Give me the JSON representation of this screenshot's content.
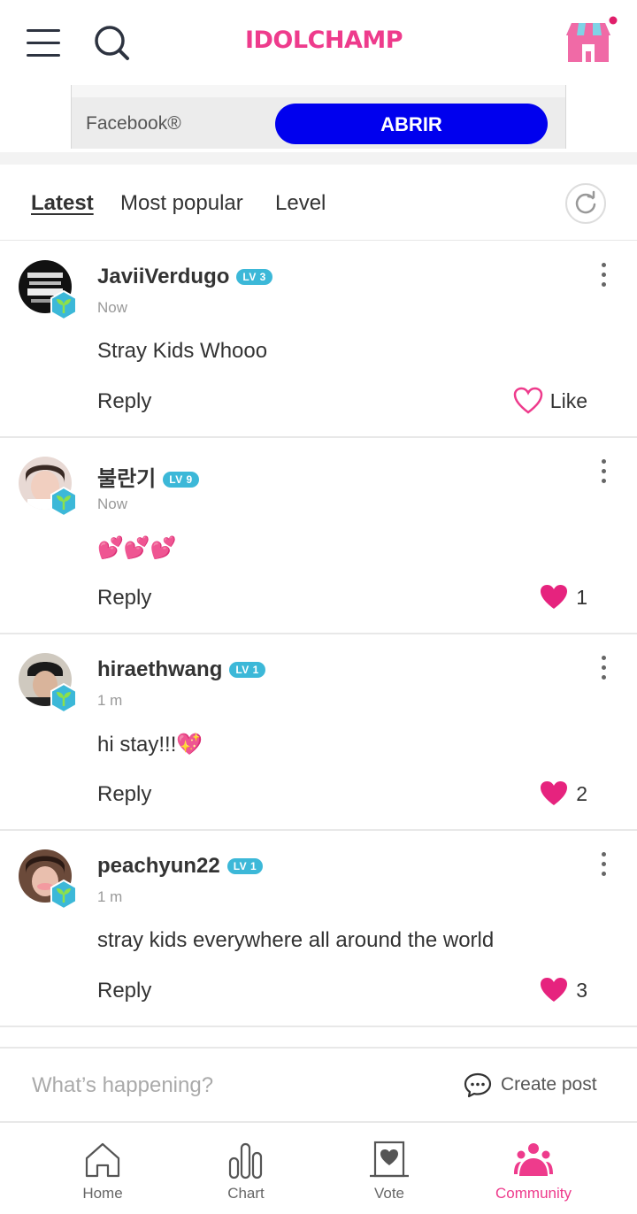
{
  "header": {
    "logo": "IDOLCHAMP",
    "menu_icon": "hamburger-menu-icon",
    "search_icon": "search-icon",
    "shop_icon": "shop-icon"
  },
  "ad": {
    "brand": "Facebook®",
    "button_label": "ABRIR",
    "button_color": "#0000ee"
  },
  "tabs": [
    {
      "label": "Latest",
      "active": true
    },
    {
      "label": "Most popular",
      "active": false
    },
    {
      "label": "Level",
      "active": false
    }
  ],
  "comments": [
    {
      "username": "JaviiVerdugo",
      "level": "LV 3",
      "time": "Now",
      "text": "Stray Kids Whooo",
      "reply_label": "Reply",
      "like_label": "Like",
      "liked": false
    },
    {
      "username": "불란기",
      "level": "LV 9",
      "time": "Now",
      "text": "💕💕💕",
      "reply_label": "Reply",
      "like_label": "1",
      "liked": true
    },
    {
      "username": "hiraethwang",
      "level": "LV 1",
      "time": "1 m",
      "text": "hi stay!!!💖",
      "reply_label": "Reply",
      "like_label": "2",
      "liked": true
    },
    {
      "username": "peachyun22",
      "level": "LV 1",
      "time": "1 m",
      "text": "stray kids everywhere all around the world",
      "reply_label": "Reply",
      "like_label": "3",
      "liked": true
    }
  ],
  "composer": {
    "placeholder": "What’s happening?",
    "create_post_label": "Create post"
  },
  "bottom_nav": [
    {
      "label": "Home",
      "icon": "home-icon",
      "active": false
    },
    {
      "label": "Chart",
      "icon": "chart-icon",
      "active": false
    },
    {
      "label": "Vote",
      "icon": "vote-icon",
      "active": false
    },
    {
      "label": "Community",
      "icon": "community-icon",
      "active": true
    }
  ],
  "colors": {
    "accent": "#ee3b8c",
    "level_badge": "#3cb8d8"
  }
}
